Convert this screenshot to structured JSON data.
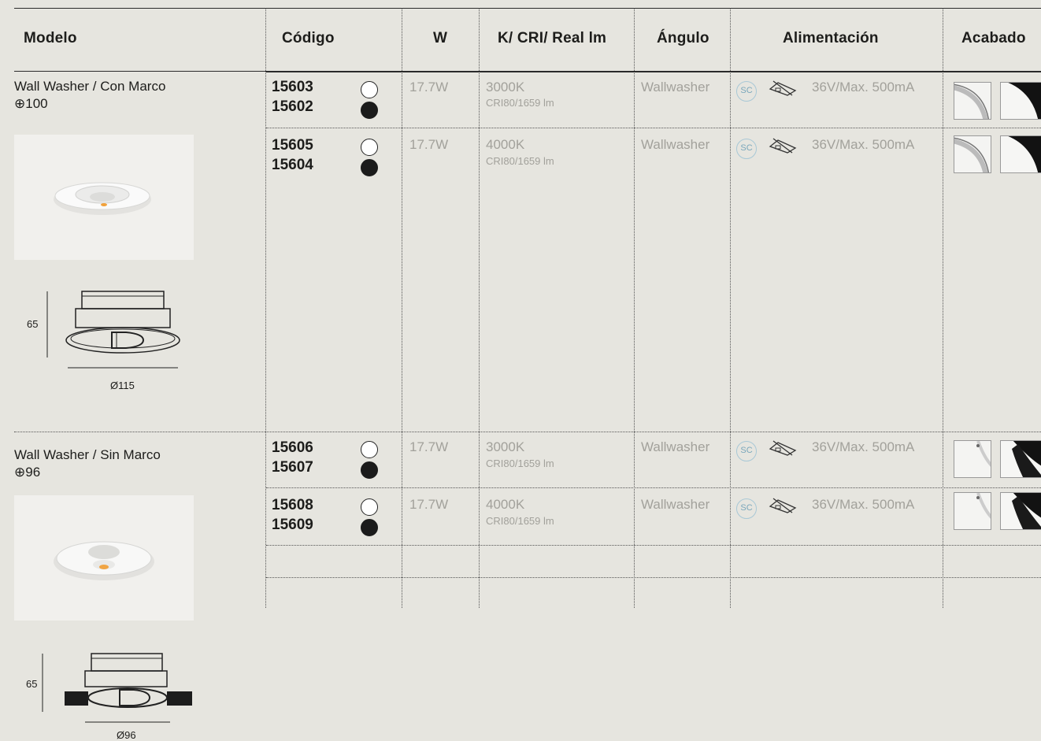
{
  "header": {
    "modelo": "Modelo",
    "codigo": "Código",
    "w": "W",
    "kcri": "K/ CRI/ Real lm",
    "angulo": "Ángulo",
    "alimentacion": "Alimentación",
    "acabado": "Acabado"
  },
  "groups": [
    {
      "title": "Wall Washer / Con Marco",
      "size": "⊕100",
      "height": "65",
      "diameter": "Ø115",
      "rows": [
        {
          "code_white": "15603",
          "code_black": "15602",
          "w": "17.7W",
          "k": "3000K",
          "cri": "CRI80/1659 lm",
          "angle": "Wallwasher",
          "sc": "SC",
          "power": "36V/Max. 500mA"
        },
        {
          "code_white": "15605",
          "code_black": "15604",
          "w": "17.7W",
          "k": "4000K",
          "cri": "CRI80/1659 lm",
          "angle": "Wallwasher",
          "sc": "SC",
          "power": "36V/Max. 500mA"
        }
      ]
    },
    {
      "title": "Wall Washer / Sin Marco",
      "size": "⊕96",
      "height": "65",
      "diameter": "Ø96",
      "rows": [
        {
          "code_white": "15606",
          "code_black": "15607",
          "w": "17.7W",
          "k": "3000K",
          "cri": "CRI80/1659 lm",
          "angle": "Wallwasher",
          "sc": "SC",
          "power": "36V/Max. 500mA"
        },
        {
          "code_white": "15608",
          "code_black": "15609",
          "w": "17.7W",
          "k": "4000K",
          "cri": "CRI80/1659 lm",
          "angle": "Wallwasher",
          "sc": "SC",
          "power": "36V/Max. 500mA"
        }
      ]
    }
  ],
  "icons": {
    "finish_white": "white-finish-swatch-icon",
    "finish_black": "black-finish-swatch-icon",
    "sc": "sc-circle-icon",
    "no_insulation": "no-insulation-lamp-icon"
  },
  "colors": {
    "background": "#e6e5df",
    "text": "#1d1d1b",
    "muted": "#a2a19b",
    "sc": "#7aa7bb"
  }
}
